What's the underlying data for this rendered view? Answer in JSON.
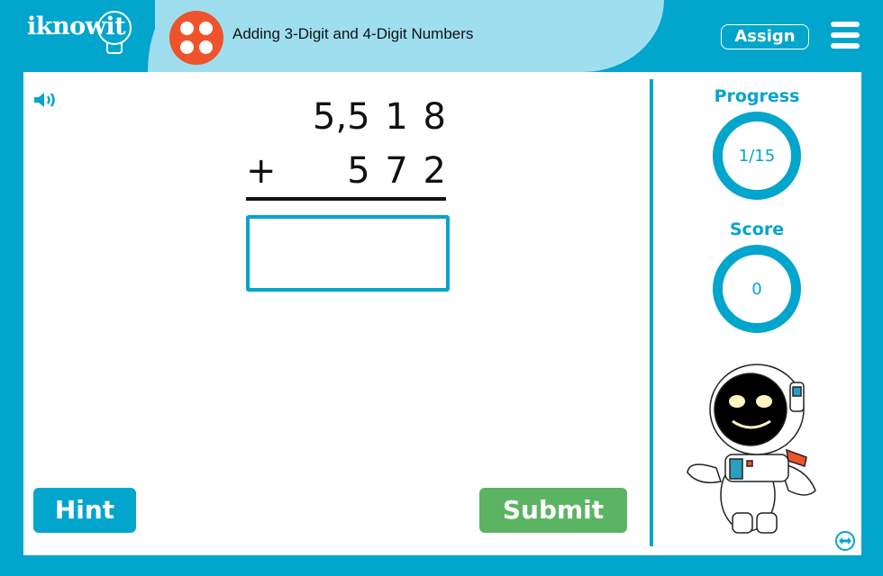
{
  "header": {
    "logo_text": "iknowit",
    "lesson_title": "Adding 3-Digit and 4-Digit Numbers",
    "lesson_icon": "four-dots-icon",
    "assign_label": "Assign",
    "menu_icon": "hamburger-menu-icon"
  },
  "problem": {
    "speaker_icon": "speaker-icon",
    "addend1": "5,518",
    "operator": "+",
    "addend2": "572",
    "answer_value": ""
  },
  "stats": {
    "progress_label": "Progress",
    "progress_value": "1/15",
    "progress_current": 1,
    "progress_total": 15,
    "score_label": "Score",
    "score_value": "0"
  },
  "buttons": {
    "hint_label": "Hint",
    "submit_label": "Submit"
  },
  "colors": {
    "brand_blue": "#02a5cc",
    "light_blue": "#9fdeef",
    "lesson_orange": "#ee532b",
    "submit_green": "#5bb461"
  }
}
